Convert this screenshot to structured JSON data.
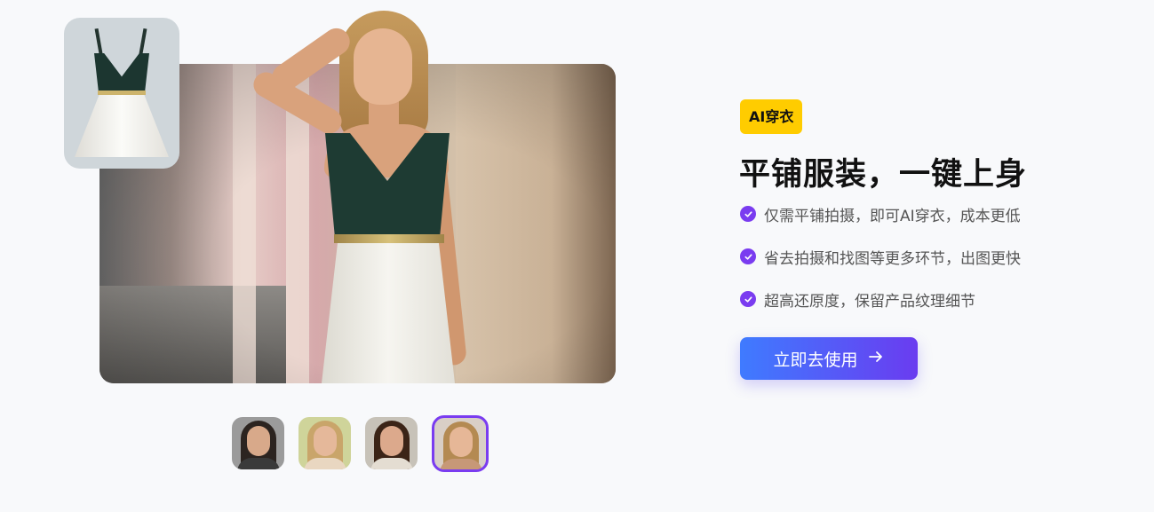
{
  "showcase": {
    "main_image_alt": "Model wearing green and white dress",
    "flatlay_alt": "Flat-lay green and white dress",
    "models": [
      {
        "name": "model-1",
        "selected": false
      },
      {
        "name": "model-2",
        "selected": false
      },
      {
        "name": "model-3",
        "selected": false
      },
      {
        "name": "model-4",
        "selected": true
      }
    ]
  },
  "badge": "AI穿衣",
  "headline": "平铺服装，一键上身",
  "features": [
    "仅需平铺拍摄，即可AI穿衣，成本更低",
    "省去拍摄和找图等更多环节，出图更快",
    "超高还原度，保留产品纹理细节"
  ],
  "cta": {
    "label": "立即去使用",
    "icon": "arrow-right-icon"
  },
  "colors": {
    "accent": "#7a3cf0",
    "badge": "#ffcc00",
    "cta_start": "#3f7bff",
    "cta_end": "#6a3cf0"
  }
}
